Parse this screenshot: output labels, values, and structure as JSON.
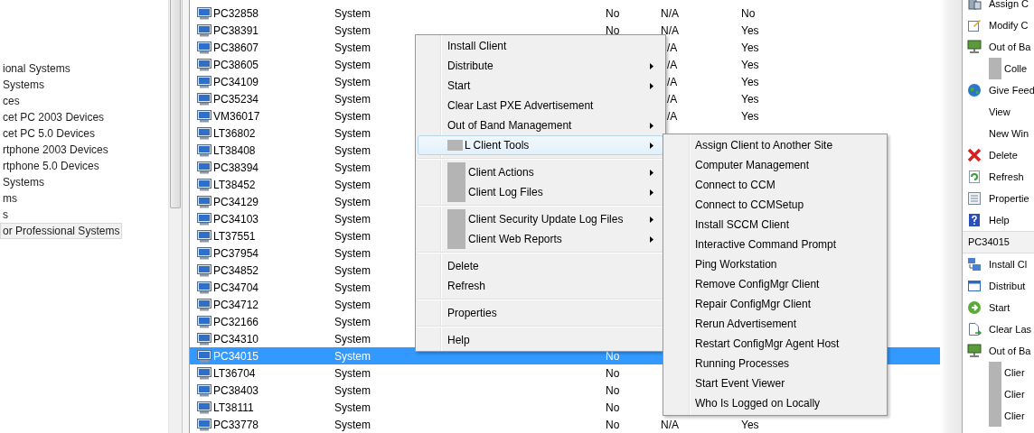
{
  "tree": {
    "items": [
      {
        "label": "ional Systems",
        "selected": false
      },
      {
        "label": "Systems",
        "selected": false
      },
      {
        "label": "ces",
        "selected": false
      },
      {
        "label": "cet PC 2003 Devices",
        "selected": false
      },
      {
        "label": "cet PC 5.0 Devices",
        "selected": false
      },
      {
        "label": "rtphone 2003 Devices",
        "selected": false
      },
      {
        "label": "rtphone 5.0 Devices",
        "selected": false
      },
      {
        "label": "Systems",
        "selected": false
      },
      {
        "label": "ms",
        "selected": false
      },
      {
        "label": "s",
        "selected": false
      },
      {
        "label": "or Professional Systems",
        "selected": true
      }
    ]
  },
  "list": {
    "rows": [
      {
        "name": "PC32858",
        "type": "System",
        "column_3": "No",
        "column_4": "N/A",
        "column_5": "No",
        "selected": false
      },
      {
        "name": "PC38391",
        "type": "System",
        "column_3": "No",
        "column_4": "N/A",
        "column_5": "Yes",
        "selected": false
      },
      {
        "name": "PC38607",
        "type": "System",
        "column_4": "/A",
        "column_5": "Yes",
        "selected": false
      },
      {
        "name": "PC38605",
        "type": "System",
        "column_4": "/A",
        "column_5": "Yes",
        "selected": false
      },
      {
        "name": "PC34109",
        "type": "System",
        "column_4": "/A",
        "column_5": "Yes",
        "selected": false
      },
      {
        "name": "PC35234",
        "type": "System",
        "column_4": "/A",
        "column_5": "Yes",
        "selected": false
      },
      {
        "name": "VM36017",
        "type": "System",
        "column_4": "/A",
        "column_5": "Yes",
        "selected": false
      },
      {
        "name": "LT36802",
        "type": "System",
        "selected": false
      },
      {
        "name": "LT38408",
        "type": "System",
        "selected": false
      },
      {
        "name": "PC38394",
        "type": "System",
        "selected": false
      },
      {
        "name": "LT38452",
        "type": "System",
        "selected": false
      },
      {
        "name": "PC34129",
        "type": "System",
        "selected": false
      },
      {
        "name": "PC34103",
        "type": "System",
        "selected": false
      },
      {
        "name": "LT37551",
        "type": "System",
        "selected": false
      },
      {
        "name": "PC37954",
        "type": "System",
        "selected": false
      },
      {
        "name": "PC34852",
        "type": "System",
        "selected": false
      },
      {
        "name": "PC34704",
        "type": "System",
        "selected": false
      },
      {
        "name": "PC34712",
        "type": "System",
        "selected": false
      },
      {
        "name": "PC32166",
        "type": "System",
        "selected": false
      },
      {
        "name": "PC34310",
        "type": "System",
        "selected": false
      },
      {
        "name": "PC34015",
        "type": "System",
        "column_3": "No",
        "selected": true
      },
      {
        "name": "LT36704",
        "type": "System",
        "column_3": "No",
        "selected": false
      },
      {
        "name": "PC38403",
        "type": "System",
        "column_3": "No",
        "selected": false
      },
      {
        "name": "LT38111",
        "type": "System",
        "column_3": "No",
        "selected": false
      },
      {
        "name": "PC33778",
        "type": "System",
        "column_3": "No",
        "column_4": "N/A",
        "column_5": "Yes",
        "selected": false
      }
    ]
  },
  "context_menu": {
    "groups": [
      {
        "items": [
          {
            "label": "Install Client",
            "submenu": false,
            "selected": false
          },
          {
            "label": "Distribute",
            "submenu": true,
            "selected": false
          },
          {
            "label": "Start",
            "submenu": true,
            "selected": false
          },
          {
            "label": "Clear Last PXE Advertisement",
            "submenu": false,
            "selected": false
          },
          {
            "label": "Out of Band Management",
            "submenu": true,
            "selected": false
          },
          {
            "label": "L Client Tools",
            "submenu": true,
            "selected": true,
            "kind": "masked"
          }
        ]
      },
      {
        "items": [
          {
            "label": "Client Actions",
            "submenu": true,
            "selected": false,
            "kind": "gutter"
          },
          {
            "label": "Client Log Files",
            "submenu": true,
            "selected": false,
            "kind": "gutter"
          }
        ]
      },
      {
        "items": [
          {
            "label": "Client Security Update Log Files",
            "submenu": true,
            "selected": false,
            "kind": "gutter"
          },
          {
            "label": "Client Web Reports",
            "submenu": true,
            "selected": false,
            "kind": "gutter"
          }
        ]
      },
      {
        "items": [
          {
            "label": "Delete",
            "submenu": false,
            "selected": false
          },
          {
            "label": "Refresh",
            "submenu": false,
            "selected": false
          }
        ]
      },
      {
        "items": [
          {
            "label": "Properties",
            "submenu": false,
            "selected": false
          }
        ]
      },
      {
        "items": [
          {
            "label": "Help",
            "submenu": false,
            "selected": false
          }
        ]
      }
    ]
  },
  "submenu": {
    "items": [
      "Assign Client to Another Site",
      "Computer Management",
      "Connect to CCM",
      "Connect to CCMSetup",
      "Install SCCM Client",
      "Interactive Command Prompt",
      "Ping Workstation",
      "Remove ConfigMgr Client",
      "Repair ConfigMgr Client",
      "Rerun Advertisement",
      "Restart ConfigMgr Agent Host",
      "Running Processes",
      "Start Event Viewer",
      "Who Is Logged on Locally"
    ]
  },
  "actions": {
    "sections": [
      {
        "items": [
          {
            "label": "Assign C",
            "kind": "assign"
          },
          {
            "label": "Modify C",
            "kind": "modify"
          },
          {
            "label": "Out of Ba",
            "kind": "network"
          },
          {
            "label": "Colle",
            "kind": "redacted"
          },
          {
            "label": "Give Feed",
            "kind": "globe"
          },
          {
            "label": "View"
          },
          {
            "label": "New Win"
          },
          {
            "label": "Delete",
            "kind": "delete"
          },
          {
            "label": "Refresh",
            "kind": "refresh"
          },
          {
            "label": "Propertie",
            "kind": "properties"
          },
          {
            "label": "Help",
            "kind": "help"
          }
        ]
      },
      {
        "header": "PC34015",
        "items": [
          {
            "label": "Install Cl",
            "kind": "install"
          },
          {
            "label": "Distribut",
            "kind": "distribute"
          },
          {
            "label": "Start",
            "kind": "start"
          },
          {
            "label": "Clear Las",
            "kind": "clear"
          },
          {
            "label": "Out of Ba",
            "kind": "network"
          },
          {
            "label": "Clier",
            "kind": "redacted"
          },
          {
            "label": "Clier",
            "kind": "redacted"
          },
          {
            "label": "Clier",
            "kind": "redacted"
          }
        ]
      }
    ]
  }
}
